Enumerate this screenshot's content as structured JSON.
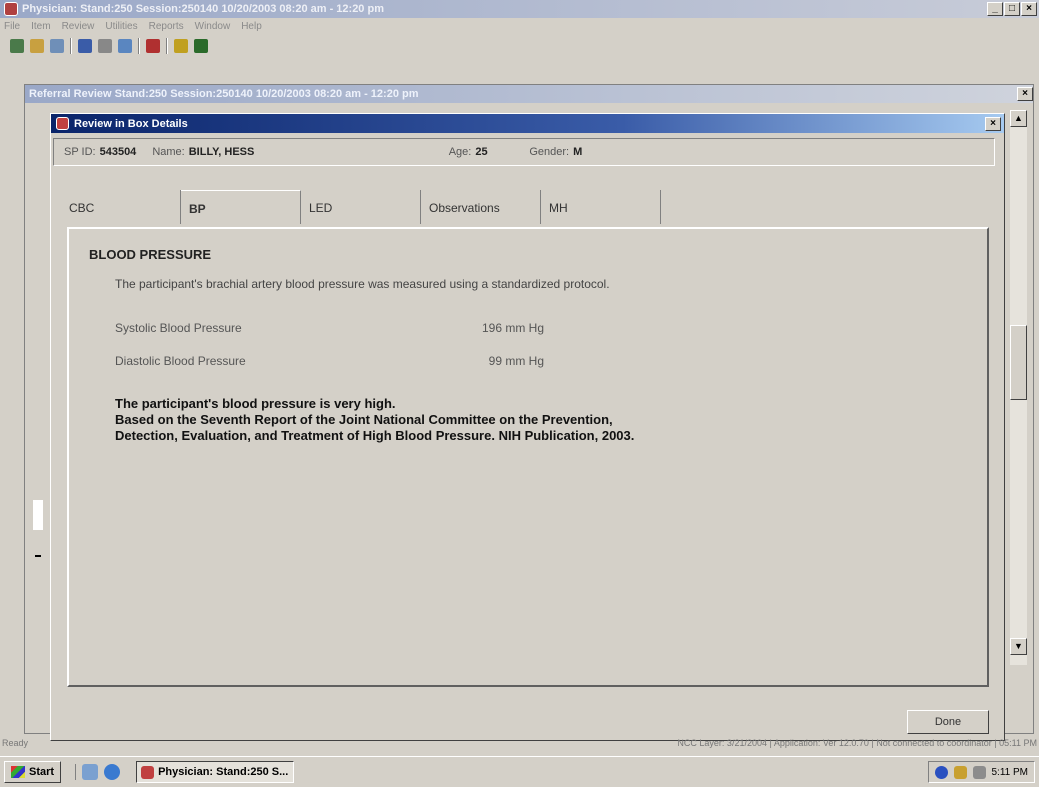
{
  "app": {
    "title": "Physician: Stand:250 Session:250140 10/20/2003 08:20 am - 12:20 pm",
    "window_buttons": [
      "_",
      "□",
      "×"
    ]
  },
  "menu": [
    "File",
    "Item",
    "Review",
    "Utilities",
    "Reports",
    "Window",
    "Help"
  ],
  "referral_window": {
    "title": "Referral Review Stand:250 Session:250140 10/20/2003 08:20 am - 12:20 pm",
    "close": "×"
  },
  "dialog": {
    "title": "Review in Box Details",
    "close": "×",
    "participant": {
      "sp_id_label": "SP ID:",
      "sp_id": "543504",
      "name_label": "Name:",
      "name": "BILLY, HESS",
      "age_label": "Age:",
      "age": "25",
      "gender_label": "Gender:",
      "gender": "M"
    },
    "tabs": [
      "CBC",
      "BP",
      "LED",
      "Observations",
      "MH"
    ],
    "active_tab": "BP",
    "section": {
      "title": "BLOOD PRESSURE",
      "intro": "The participant's brachial artery blood pressure was measured using a standardized protocol.",
      "rows": [
        {
          "label": "Systolic Blood Pressure",
          "value": "196 mm Hg"
        },
        {
          "label": "Diastolic Blood Pressure",
          "value": "99 mm Hg"
        }
      ],
      "finding_line1": "The participant's blood pressure is very high.",
      "finding_line2": "Based on the Seventh Report of the Joint National Committee on the Prevention,",
      "finding_line3": "Detection, Evaluation, and Treatment of High Blood Pressure. NIH Publication, 2003."
    },
    "done_label": "Done"
  },
  "statusbar": {
    "ready": "Ready",
    "segments": "NCC Layer: 3/21/2004 | Application: Ver 12.0.70 | Not connected to coordinator | 05:11 PM"
  },
  "taskbar": {
    "start": "Start",
    "task": "Physician: Stand:250 S...",
    "clock": "5:11 PM"
  },
  "colors": {
    "dialog_title_gradient_start": "#0a246a",
    "window_face": "#d4d0c8"
  }
}
